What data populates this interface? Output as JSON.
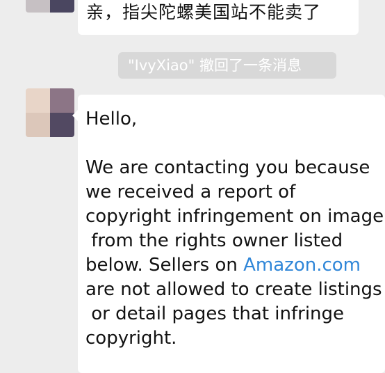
{
  "chat": {
    "top_message": "亲，指尖陀螺美国站不能卖了",
    "recall_notice": {
      "name": "\"IvyXiao\"",
      "action": "撤回了一条消息"
    },
    "main_message": {
      "greeting": "Hello,",
      "line2": "We are contacting you because",
      "line3": "we received a report of",
      "line4": "copyright infringement on image",
      "line5": " from the rights owner listed",
      "line6_before": "below. Sellers on ",
      "line6_link": "Amazon.com",
      "line7": "are not allowed to create listings",
      "line8": " or detail pages that infringe",
      "line9": "copyright."
    }
  }
}
